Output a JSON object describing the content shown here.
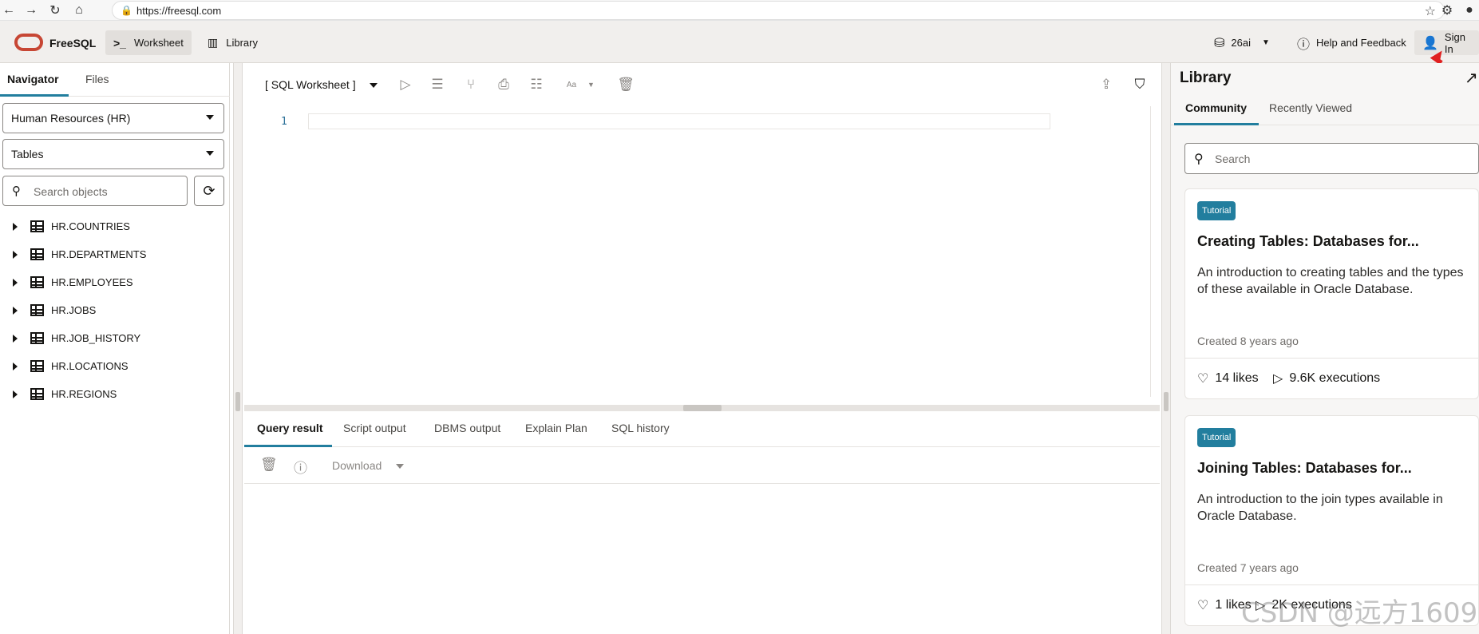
{
  "browser": {
    "url": "https://freesql.com"
  },
  "header": {
    "brand": "FreeSQL",
    "nav": [
      {
        "label": "Worksheet",
        "icon": "terminal-icon"
      },
      {
        "label": "Library",
        "icon": "library-icon"
      }
    ],
    "version": "26ai",
    "help": "Help and Feedback",
    "signin": "Sign In"
  },
  "navigator": {
    "tabs": [
      "Navigator",
      "Files"
    ],
    "schema": "Human Resources (HR)",
    "object_type": "Tables",
    "search_placeholder": "Search objects",
    "tables": [
      "HR.COUNTRIES",
      "HR.DEPARTMENTS",
      "HR.EMPLOYEES",
      "HR.JOBS",
      "HR.JOB_HISTORY",
      "HR.LOCATIONS",
      "HR.REGIONS"
    ]
  },
  "worksheet": {
    "title": "[ SQL Worksheet ]",
    "font_label": "Aa",
    "line_number": "1",
    "result_tabs": [
      "Query result",
      "Script output",
      "DBMS output",
      "Explain Plan",
      "SQL history"
    ],
    "download": "Download"
  },
  "library": {
    "title": "Library",
    "tabs": [
      "Community",
      "Recently Viewed"
    ],
    "search_placeholder": "Search",
    "cards": [
      {
        "badge": "Tutorial",
        "title": "Creating Tables: Databases for...",
        "desc": "An introduction to creating tables and the types of these available in Oracle Database.",
        "created": "Created 8 years ago",
        "likes": "14 likes",
        "executions": "9.6K executions"
      },
      {
        "badge": "Tutorial",
        "title": "Joining Tables: Databases for...",
        "desc": "An introduction to the join types available in Oracle Database.",
        "created": "Created 7 years ago",
        "likes": "1 likes",
        "executions": "2K executions"
      }
    ]
  },
  "watermark": "CSDN @远方1609",
  "colors": {
    "accent": "#227e9e",
    "brand_red": "#c74634",
    "header_bg": "#f1efed"
  }
}
